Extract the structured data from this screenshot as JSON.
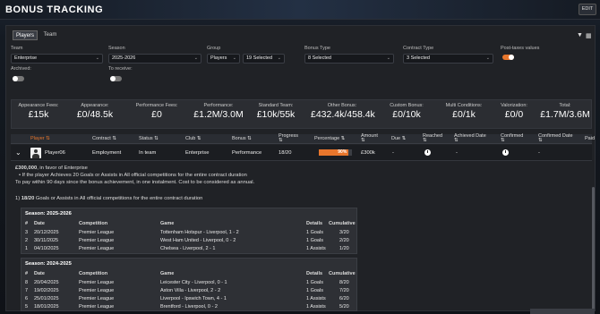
{
  "header": {
    "title": "BONUS TRACKING",
    "edit": "EDIT"
  },
  "tabs": [
    "Players",
    "Team"
  ],
  "filters": {
    "team": {
      "label": "Team",
      "value": "Enterprise"
    },
    "season": {
      "label": "Season",
      "value": "2025-2026"
    },
    "group": {
      "label": "Group",
      "value": "Players",
      "value2": "19 Selected"
    },
    "bonus_type": {
      "label": "Bonus Type",
      "value": "8 Selected"
    },
    "contract_type": {
      "label": "Contract Type",
      "value": "3 Selected"
    },
    "post_taxes": {
      "label": "Post-taxes values",
      "on": true
    },
    "archived": {
      "label": "Archived:",
      "on": false
    },
    "to_receive": {
      "label": "To receive:",
      "on": false
    }
  },
  "summary": [
    {
      "label": "Appearance Fees:",
      "value": "£15k"
    },
    {
      "label": "Appearance:",
      "value": "£0/48.5k"
    },
    {
      "label": "Performance Fees:",
      "value": "£0"
    },
    {
      "label": "Performance:",
      "value": "£1.2M/3.0M"
    },
    {
      "label": "Standard Team:",
      "value": "£10k/55k"
    },
    {
      "label": "Other Bonus:",
      "value": "£432.4k/458.4k"
    },
    {
      "label": "Custom Bonus:",
      "value": "£0/10k"
    },
    {
      "label": "Multi Conditions:",
      "value": "£0/1k"
    },
    {
      "label": "Valorization:",
      "value": "£0/0"
    },
    {
      "label": "Total:",
      "value": "£1.7M/3.6M"
    }
  ],
  "columns": [
    "Player",
    "Contract",
    "Status",
    "Club",
    "Bonus",
    "Progress",
    "Percentage",
    "Amount",
    "Due",
    "Reached",
    "Achieved Date",
    "Confirmed",
    "Confirmed Date",
    "Paid"
  ],
  "row": {
    "player": "Player06",
    "contract": "Employment",
    "status": "In team",
    "club": "Enterprise",
    "bonus": "Performance",
    "progress": "18/20",
    "percentage": "90%",
    "percentage_value": 90,
    "amount": "£300k",
    "due": "-",
    "achieved_date": "-",
    "confirmed_date": "-"
  },
  "details": {
    "amount": "£300,000",
    "amount_rest": ", in favor of Enterprise",
    "condition": "If the player Achieves 20 Goals or Assists in All official competitions for the entire contract duration",
    "payment": "To pay within 90 days since the bonus achievement, in one instalment. Cost to be considered as annual.",
    "progress_prefix": "1)",
    "progress_value": "18/20",
    "progress_text": "Goals or Assists in All official competitions for the entire contract duration"
  },
  "table_columns": [
    "#",
    "Date",
    "Competition",
    "Game",
    "Details",
    "Cumulative"
  ],
  "seasons": [
    {
      "title": "Season: 2025-2026",
      "rows": [
        [
          "3",
          "20/12/2025",
          "Premier League",
          "Tottenham Hotspur - Liverpool, 1 - 2",
          "1 Goals",
          "3/20"
        ],
        [
          "2",
          "30/11/2025",
          "Premier League",
          "West Ham United - Liverpool, 0 - 2",
          "1 Goals",
          "2/20"
        ],
        [
          "1",
          "04/10/2025",
          "Premier League",
          "Chelsea - Liverpool, 2 - 1",
          "1 Assists",
          "1/20"
        ]
      ]
    },
    {
      "title": "Season: 2024-2025",
      "rows": [
        [
          "8",
          "20/04/2025",
          "Premier League",
          "Leicester City - Liverpool, 0 - 1",
          "1 Goals",
          "8/20"
        ],
        [
          "7",
          "19/02/2025",
          "Premier League",
          "Aston Villa - Liverpool, 2 - 2",
          "1 Goals",
          "7/20"
        ],
        [
          "6",
          "25/01/2025",
          "Premier League",
          "Liverpool - Ipswich Town, 4 - 1",
          "1 Assists",
          "6/20"
        ],
        [
          "5",
          "18/01/2025",
          "Premier League",
          "Brentford - Liverpool, 0 - 2",
          "1 Assists",
          "5/20"
        ]
      ]
    }
  ],
  "colors": {
    "accent": "#e8762c"
  }
}
